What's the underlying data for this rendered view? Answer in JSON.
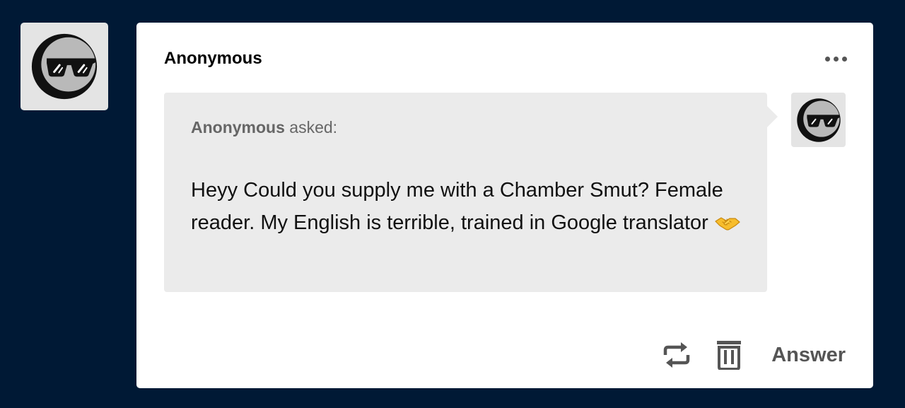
{
  "post": {
    "blog_name": "Anonymous",
    "more_icon": "more-horizontal-icon",
    "side_avatar_icon": "sunglasses-moon-avatar-icon"
  },
  "ask": {
    "asker_name": "Anonymous",
    "asked_label": "asked:",
    "question": "Heyy Could you supply me with a Chamber Smut? Female reader. My English is terrible, trained in Google translator",
    "emoji": "handshake-emoji",
    "asker_avatar_icon": "sunglasses-moon-avatar-icon"
  },
  "actions": {
    "reblog_icon": "reblog-icon",
    "delete_icon": "trash-icon",
    "answer_label": "Answer"
  },
  "colors": {
    "page_background": "#001935",
    "card_background": "#ffffff",
    "bubble_background": "#ebebeb",
    "avatar_background": "#e4e4e4",
    "icon_gray": "#555555"
  }
}
